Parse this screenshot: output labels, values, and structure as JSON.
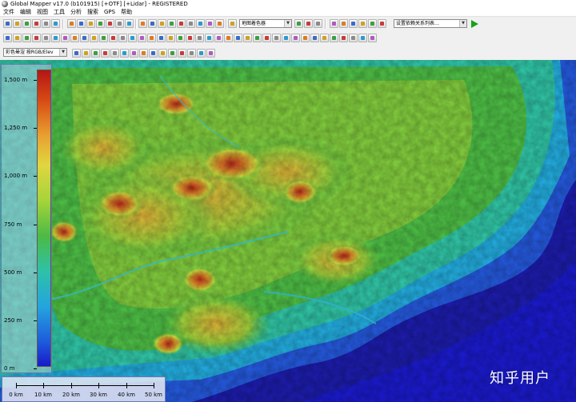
{
  "window": {
    "title": "Global Mapper v17.0 (b101915) [+OTF] [+Lidar] - REGISTERED"
  },
  "menu": {
    "items": [
      "文件",
      "编辑",
      "视图",
      "工具",
      "分析",
      "搜索",
      "GPS",
      "帮助"
    ]
  },
  "toolbar": {
    "layer_combo": "地图着色器",
    "config_combo": "设置依赖关系列表…",
    "shader_combo": "彩色晕渲 按RGB/Elev"
  },
  "legend": {
    "ticks": [
      "1,500 m",
      "1,250 m",
      "1,000 m",
      "750 m",
      "500 m",
      "250 m",
      "0 m"
    ]
  },
  "scale_bar": {
    "labels": [
      "0 km",
      "10 km",
      "20 km",
      "30 km",
      "40 km",
      "50 km"
    ]
  },
  "watermark": {
    "text": "知乎用户"
  },
  "colors": {
    "high": "#b51515",
    "mid": "#4cba44",
    "low": "#1a1ac8",
    "sea": "#1c1ca8"
  }
}
